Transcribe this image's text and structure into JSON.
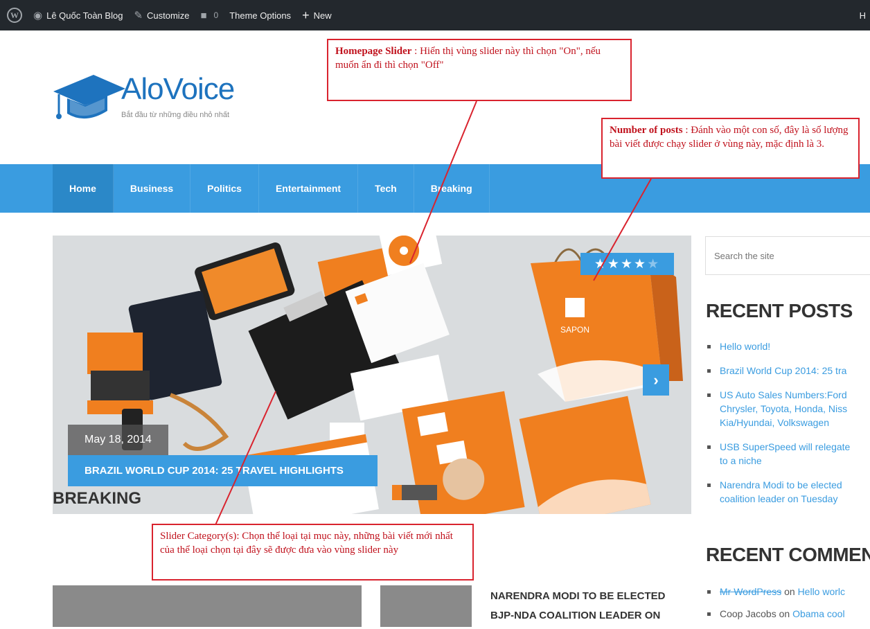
{
  "adminbar": {
    "site_name": "Lê Quốc Toàn Blog",
    "customize": "Customize",
    "comments_count": "0",
    "theme_options": "Theme Options",
    "new": "New",
    "right_text": "H"
  },
  "logo": {
    "name": "AloVoice",
    "tagline": "Bắt đầu từ những điều nhỏ nhất"
  },
  "nav": {
    "items": [
      "Home",
      "Business",
      "Politics",
      "Entertainment",
      "Tech",
      "Breaking"
    ]
  },
  "slider": {
    "rating": 4,
    "rating_max": 5,
    "date": "May 18, 2014",
    "title": "BRAZIL WORLD CUP 2014: 25 TRAVEL HIGHLIGHTS",
    "next_icon": "chevron-right-icon",
    "brand_text": "SAPON"
  },
  "sidebar": {
    "search_placeholder": "Search the site",
    "recent_posts_title": "RECENT POSTS",
    "recent_posts": [
      "Hello world!",
      "Brazil World Cup 2014: 25 tra",
      "US Auto Sales Numbers:Ford\nChrysler, Toyota, Honda, Niss\nKia/Hyundai, Volkswagen",
      "USB SuperSpeed will relegate\nto a niche",
      "Narendra Modi to be elected\ncoalition leader on Tuesday"
    ],
    "recent_comments_title": "RECENT COMMEN",
    "recent_comments": [
      {
        "author": "Mr WordPress",
        "on": " on ",
        "post": "Hello worlc"
      },
      {
        "author": "Coop Jacobs",
        "on": " on ",
        "post": "Obama cool"
      }
    ]
  },
  "breaking": {
    "title": "BREAKING",
    "post_title_line1": "NARENDRA MODI TO BE ELECTED",
    "post_title_line2": "BJP-NDA COALITION LEADER ON"
  },
  "annotations": {
    "homepage_slider_label": "Homepage Slider",
    "homepage_slider_text": " : Hiển thị vùng slider này thì chọn \"On\", nếu muốn ẩn đi thì chọn \"Off\"",
    "number_of_posts_label": "Number of posts",
    "number_of_posts_text": " : Đánh vào một con số, đây là số lượng bài viết được chạy slider ở vùng này, mặc định là 3.",
    "slider_category_label": "Slider Category(s)",
    "slider_category_text": ": Chọn thể loại tại mục này, những bài viết mới nhất của thể loại chọn tại đây sẽ được đưa vào vùng slider này"
  },
  "colors": {
    "accent": "#3a9ce0",
    "adminbar": "#23282d",
    "annotation": "#d9232e",
    "brand_orange": "#f07f1f"
  }
}
